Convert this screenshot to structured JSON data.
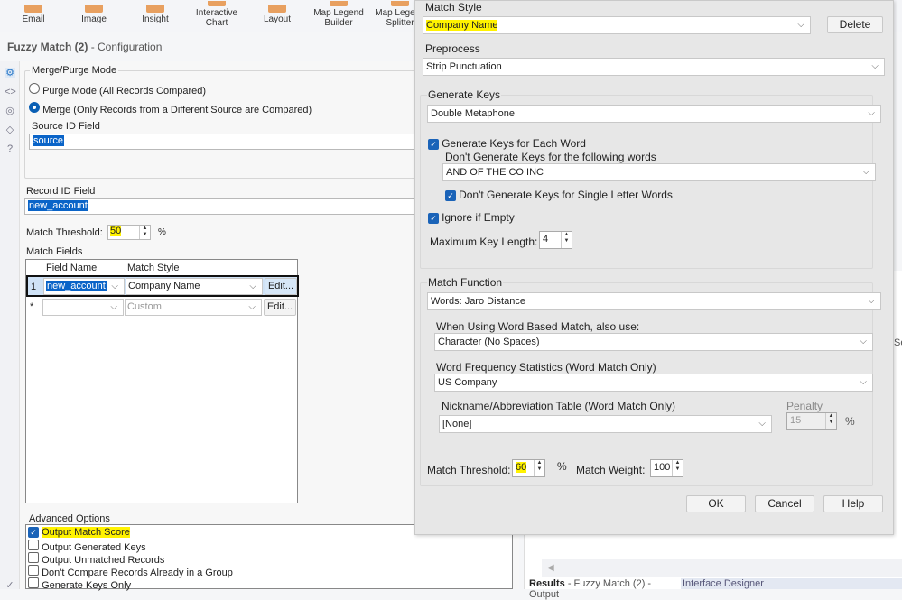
{
  "toolbar": {
    "tools": [
      "Email",
      "Image",
      "Insight",
      "Interactive Chart",
      "Layout",
      "Map Legend Builder",
      "Map Legend Splitter"
    ]
  },
  "config": {
    "tool_name": "Fuzzy Match (2)",
    "suffix": "- Configuration",
    "merge_purge": {
      "title": "Merge/Purge Mode",
      "purge_label": "Purge Mode (All Records Compared)",
      "merge_label": "Merge (Only Records from a Different Source are Compared)",
      "source_id_label": "Source ID Field",
      "source_id_value": "source"
    },
    "record_id_label": "Record ID Field",
    "record_id_value": "new_account",
    "threshold_label": "Match Threshold:",
    "threshold_value": "50",
    "percent": "%",
    "match_fields_label": "Match Fields",
    "grid": {
      "headers": [
        "Field Name",
        "Match Style"
      ],
      "rows": [
        {
          "num": "1",
          "field": "new_account",
          "style": "Company Name",
          "edit": "Edit..."
        },
        {
          "num": "*",
          "field": "",
          "style": "Custom",
          "edit": "Edit..."
        }
      ]
    },
    "advanced": {
      "title": "Advanced Options",
      "options": [
        {
          "label": "Output Match Score",
          "checked": true
        },
        {
          "label": "Output Generated Keys",
          "checked": false
        },
        {
          "label": "Output Unmatched Records",
          "checked": false
        },
        {
          "label": "Don't Compare Records Already in a Group",
          "checked": false
        },
        {
          "label": "Generate Keys Only",
          "checked": false
        }
      ]
    }
  },
  "bottom_tabs": {
    "results": "Results",
    "results_detail": "- Fuzzy Match (2) - Output",
    "interface": "Interface Designer"
  },
  "dialog": {
    "match_style_label": "Match Style",
    "match_style_value": "Company Name",
    "delete": "Delete",
    "preprocess_label": "Preprocess",
    "preprocess_value": "Strip Punctuation",
    "gen_keys_label": "Generate Keys",
    "gen_keys_value": "Double Metaphone",
    "each_word_label": "Generate Keys for Each Word",
    "skip_words_label": "Don't Generate Keys for the following words",
    "skip_words_value": "AND OF THE CO INC",
    "single_letter_label": "Don't Generate Keys for Single Letter Words",
    "ignore_empty_label": "Ignore if Empty",
    "max_key_label": "Maximum Key Length:",
    "max_key_value": "4",
    "match_function_label": "Match Function",
    "match_function_value": "Words: Jaro Distance",
    "word_based_label": "When Using Word Based Match, also use:",
    "word_based_value": "Character (No Spaces)",
    "freq_label": "Word Frequency Statistics (Word Match Only)",
    "freq_value": "US Company",
    "nickname_label": "Nickname/Abbreviation Table (Word Match Only)",
    "nickname_value": "[None]",
    "penalty_label": "Penalty",
    "penalty_value": "15",
    "percent": "%",
    "threshold_label": "Match Threshold:",
    "threshold_value": "60",
    "weight_label": "Match Weight:",
    "weight_value": "100",
    "ok": "OK",
    "cancel": "Cancel",
    "help": "Help"
  },
  "background": {
    "partial_text": "Se"
  }
}
